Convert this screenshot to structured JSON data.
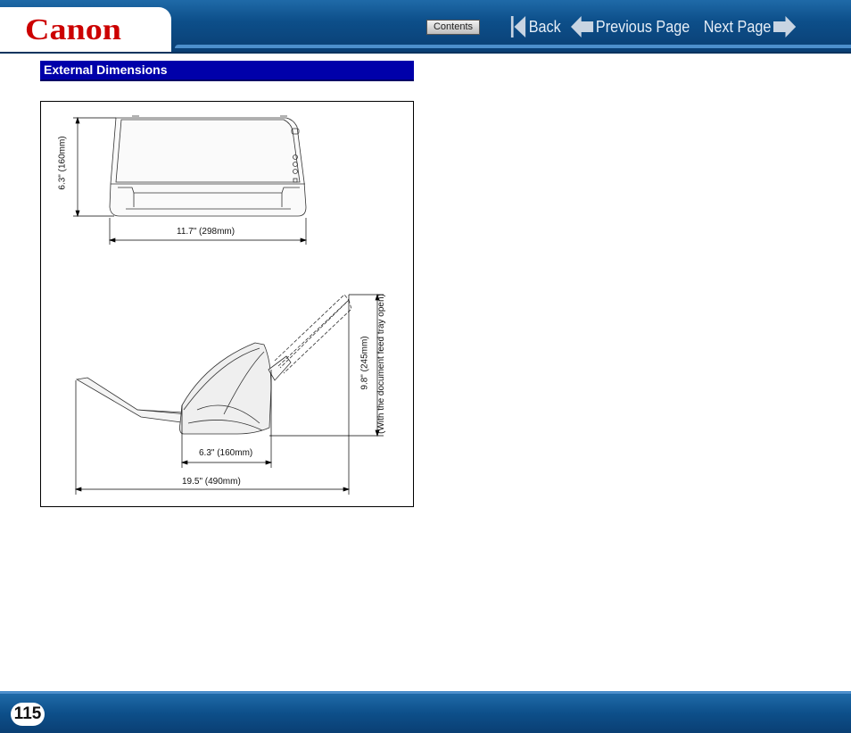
{
  "header": {
    "logo": "Canon",
    "contents_label": "Contents",
    "back_label": "Back",
    "prev_label": "Previous Page",
    "next_label": "Next Page",
    "colors": {
      "header_blue": "#0d4f8a",
      "logo_red": "#cc0000"
    }
  },
  "section": {
    "title": "External Dimensions",
    "title_bg": "#0000aa"
  },
  "figure": {
    "top_height": "6.3\" (160mm)",
    "top_width": "11.7\" (298mm)",
    "side_depth": "6.3\" (160mm)",
    "side_total": "19.5\" (490mm)",
    "side_height": "9.8\" (245mm)",
    "side_height_note": "(With the document feed tray open)"
  },
  "footer": {
    "page_number": "115"
  }
}
